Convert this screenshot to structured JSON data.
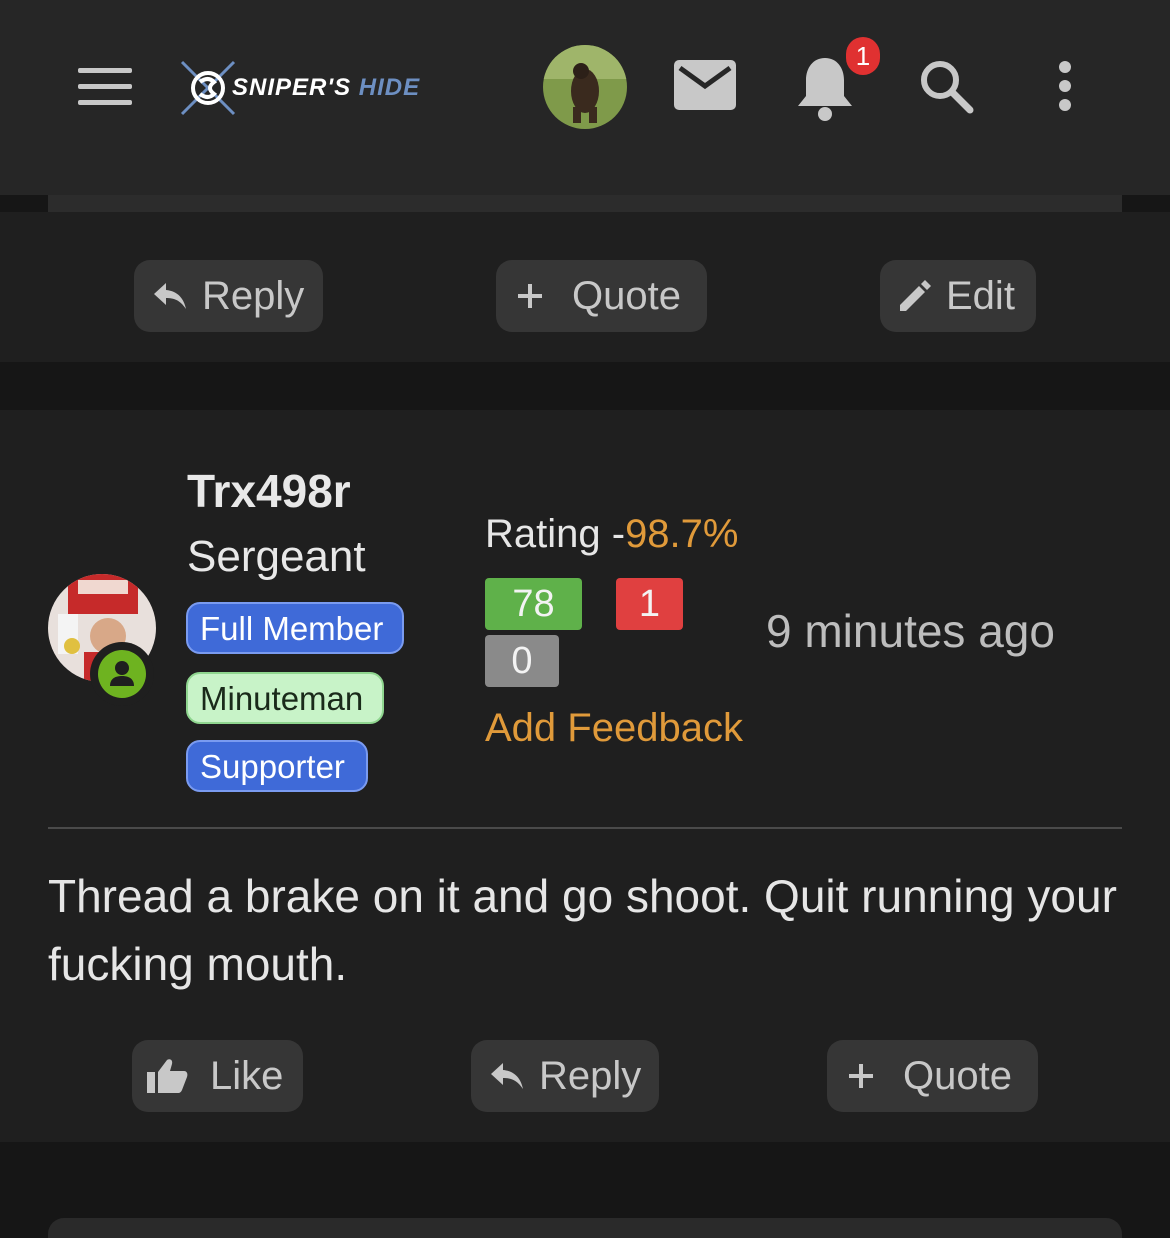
{
  "header": {
    "logo_text_primary": "SNIPER'S",
    "logo_text_secondary": "HIDE",
    "notification_count": "1",
    "icons": [
      "menu-icon",
      "sniper-logo",
      "avatar",
      "mail-icon",
      "bell-icon",
      "search-icon",
      "more-vertical-icon"
    ]
  },
  "previous_post_actions": {
    "reply_label": "Reply",
    "quote_label": "Quote",
    "edit_label": "Edit"
  },
  "post": {
    "username": "Trx498r",
    "rank": "Sergeant",
    "badges": [
      "Full Member",
      "Minuteman",
      "Supporter"
    ],
    "rating_label": "Rating -",
    "rating_value": "98.7%",
    "positive_count": "78",
    "negative_count": "1",
    "neutral_count": "0",
    "add_feedback": "Add Feedback",
    "timestamp": "9 minutes ago",
    "body": "Thread a brake on it and go shoot. Quit running your fucking mouth.",
    "actions": {
      "like_label": "Like",
      "reply_label": "Reply",
      "quote_label": "Quote"
    }
  },
  "colors": {
    "accent_orange": "#e09a3a",
    "positive_green": "#5fb14a",
    "negative_red": "#e04040",
    "neutral_gray": "#8a8a8a",
    "badge_blue": "#3f6ad8",
    "badge_green": "#c8f3c8",
    "notification_red": "#e03131",
    "online_green": "#6eb320"
  }
}
